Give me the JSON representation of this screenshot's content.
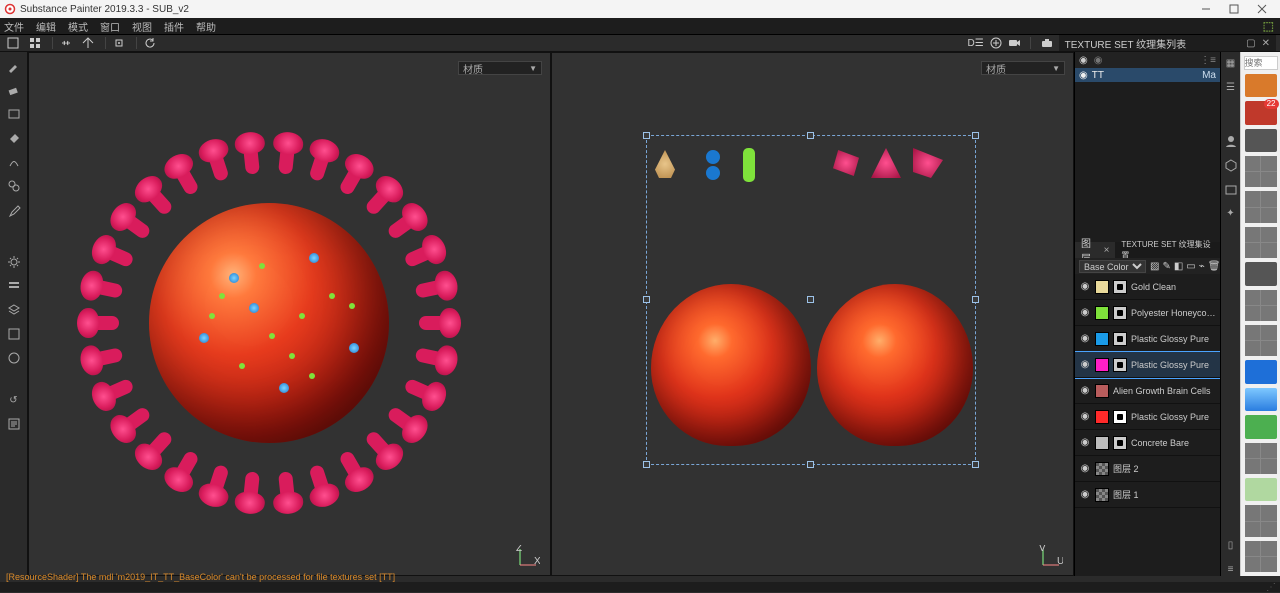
{
  "titlebar": {
    "title": "Substance Painter 2019.3.3 - SUB_v2"
  },
  "menu": {
    "items": [
      "文件",
      "编辑",
      "模式",
      "窗口",
      "视图",
      "插件",
      "帮助"
    ]
  },
  "toolbar_right_panel_title": "TEXTURE SET 纹理集列表",
  "viewport": {
    "left_dropdown": "材质",
    "right_dropdown": "材质",
    "left_axis": {
      "x": "X",
      "z": "Z"
    },
    "right_axis": {
      "v": "V",
      "u": "U"
    }
  },
  "texture_set": {
    "eye_icon": "eye",
    "name": "TT",
    "edit_label": "Ma"
  },
  "layer_panel": {
    "tab_layers": "图层",
    "tab_settings": "TEXTURE SET 纹理集设置",
    "channel_select": "Base Color",
    "layers": [
      {
        "color": "#e9d99a",
        "mask": true,
        "name": "Gold Clean"
      },
      {
        "color": "#7fe23b",
        "mask": true,
        "name": "Polyester Honeycomb Mesh Fr"
      },
      {
        "color": "#1a9be8",
        "mask": true,
        "name": "Plastic Glossy Pure"
      },
      {
        "color": "#ff1fc6",
        "mask": true,
        "name": "Plastic Glossy Pure",
        "selected": true
      },
      {
        "color": "#b85c5c",
        "mask": false,
        "name": "Alien Growth Brain Cells"
      },
      {
        "color": "#ff2a2a",
        "mask": true,
        "name": "Plastic Glossy Pure",
        "redmask": true
      },
      {
        "color": "#bdbdbd",
        "mask": true,
        "name": "Concrete Bare"
      },
      {
        "color": "checker",
        "mask": false,
        "name": "图层 2"
      },
      {
        "color": "checker",
        "mask": false,
        "name": "图层 1"
      }
    ]
  },
  "dock": {
    "search_placeholder": "搜索"
  },
  "thumb_badge": "22",
  "status": "[ResourceShader] The mdl 'm2019_IT_TT_BaseColor' can't be processed for file textures set [TT]"
}
